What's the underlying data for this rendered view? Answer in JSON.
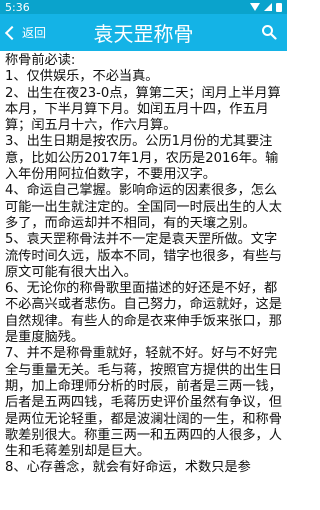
{
  "status_bar": {
    "time": "5:36"
  },
  "header": {
    "back_label": "返回",
    "title": "袁天罡称骨"
  },
  "content": {
    "text": "称骨前必读:\n1、仅供娱乐，不必当真。\n2、出生在夜23-0点，算第二天；闰月上半月算本月，下半月算下月。如闰五月十四，作五月算；闰五月十六，作六月算。\n3、出生日期是按农历。公历1月份的尤其要注意，比如公历2017年1月，农历是2016年。输入年份用阿拉伯数字，不要用汉字。\n4、命运自己掌握。影响命运的因素很多，怎么可能一出生就注定的。全国同一时辰出生的人太多了，而命运却并不相同，有的天壤之别。\n5、袁天罡称骨法并不一定是袁天罡所做。文字流传时间久远，版本不同，错字也很多，有些与原文可能有很大出入。\n6、无论你的称骨歌里面描述的好还是不好，都不必高兴或者悲伤。自己努力，命运就好，这是自然规律。有些人的命是衣来伸手饭来张口，那是重度脑残。\n7、并不是称骨重就好，轻就不好。好与不好完全与重量无关。毛与蒋，按照官方提供的出生日期，加上命理师分析的时辰，前者是三两一钱，后者是五两四钱，毛蒋历史评价虽然有争议，但是两位无论轻重，都是波澜壮阔的一生，和称骨歌差别很大。称重三两一和五两四的人很多，人生和毛蒋差别却是巨大。\n8、心存善念，就会有好命运，术数只是参"
  }
}
